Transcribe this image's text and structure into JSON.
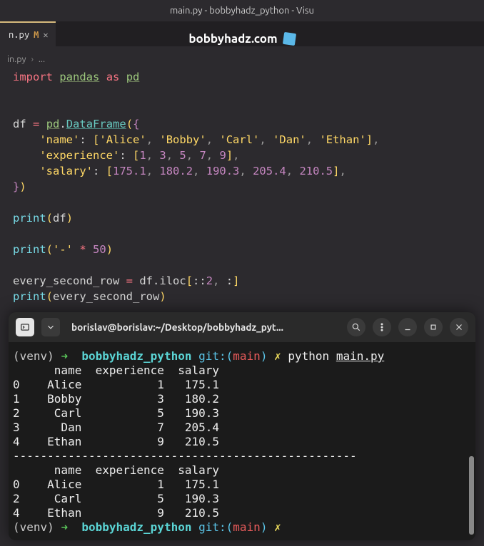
{
  "window": {
    "title": "main.py - bobbyhadz_python - Visu"
  },
  "tab": {
    "filename": "n.py",
    "modified_marker": "M",
    "close_glyph": "✕"
  },
  "banner": {
    "site": "bobbyhadz.com"
  },
  "breadcrumb": {
    "file": "in.py",
    "sep": "›",
    "more": "..."
  },
  "code": {
    "t": {
      "import": "import",
      "pandas": "pandas",
      "as": "as",
      "pd": "pd",
      "df": "df",
      "eq": "=",
      "dot": ".",
      "DataFrame": "DataFrame",
      "lparen": "(",
      "lbrace": "{",
      "k_name": "'name'",
      "colon": ":",
      "lbr": "[",
      "alice": "'Alice'",
      "bobby": "'Bobby'",
      "carl": "'Carl'",
      "dan": "'Dan'",
      "ethan": "'Ethan'",
      "rbr": "]",
      "comma": ",",
      "k_exp": "'experience'",
      "n1": "1",
      "n3": "3",
      "n5": "5",
      "n7": "7",
      "n9": "9",
      "k_sal": "'salary'",
      "s1": "175.1",
      "s2": "180.2",
      "s3": "190.3",
      "s4": "205.4",
      "s5": "210.5",
      "rbrace": "}",
      "rparen": ")",
      "print": "print",
      "dash": "'-'",
      "star": "*",
      "fifty": "50",
      "esr": "every_second_row",
      "iloc": "iloc",
      "slice": "::",
      "two": "2",
      "slcolon": ":"
    }
  },
  "terminal": {
    "title": "borislav@borislav:~/Desktop/bobbyhadz_pyt...",
    "prompt": {
      "venv": "(venv)",
      "arrow": "➜",
      "dir": "bobbyhadz_python",
      "git": "git:",
      "branch": "main",
      "star": "✗",
      "python": "python",
      "script": "main.py",
      "lp": "(",
      "rp": ")"
    },
    "output": {
      "header": "      name  experience  salary",
      "row0": "0    Alice           1   175.1",
      "row1": "1    Bobby           3   180.2",
      "row2": "2     Carl           5   190.3",
      "row3": "3      Dan           7   205.4",
      "row4": "4    Ethan           9   210.5",
      "sep": "--------------------------------------------------",
      "header2": "      name  experience  salary",
      "r2_0": "0    Alice           1   175.1",
      "r2_2": "2     Carl           5   190.3",
      "r2_4": "4    Ethan           9   210.5"
    }
  }
}
